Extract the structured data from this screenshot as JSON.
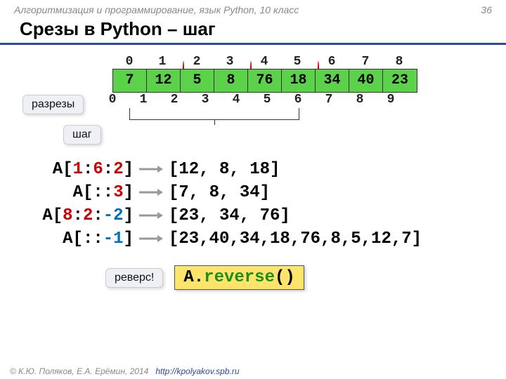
{
  "header": {
    "course": "Алгоритмизация и программирование, язык Python, 10 класс",
    "page": "36"
  },
  "title": "Срезы в Python – шаг",
  "array": {
    "top_indices": [
      "0",
      "1",
      "2",
      "3",
      "4",
      "5",
      "6",
      "7",
      "8"
    ],
    "circled_top": [
      1,
      3,
      5
    ],
    "values": [
      "7",
      "12",
      "5",
      "8",
      "76",
      "18",
      "34",
      "40",
      "23"
    ],
    "bottom_indices": [
      "0",
      "1",
      "2",
      "3",
      "4",
      "5",
      "6",
      "7",
      "8",
      "9"
    ]
  },
  "callouts": {
    "slices": "разрезы",
    "step": "шаг",
    "reverse": "реверс!"
  },
  "examples": [
    {
      "expr": {
        "open": "A[",
        "a": "1",
        "c1": ":",
        "b": "6",
        "c2": ":",
        "step": "2",
        "close": "]"
      },
      "result": "[12, 8, 18]"
    },
    {
      "expr": {
        "open": "A[",
        "a": "",
        "c1": ":",
        "b": "",
        "c2": ":",
        "step": "3",
        "close": "]"
      },
      "result": "[7, 8, 34]"
    },
    {
      "expr": {
        "open": "A[",
        "a": "8",
        "c1": ":",
        "b": "2",
        "c2": ":",
        "step": "-2",
        "close": "]"
      },
      "result": "[23, 34, 76]"
    },
    {
      "expr": {
        "open": "A[",
        "a": "",
        "c1": ":",
        "b": "",
        "c2": ":",
        "step": "-1",
        "close": "]"
      },
      "result": "[23,40,34,18,76,8,5,12,7]"
    }
  ],
  "reverse_code": {
    "obj": "A.",
    "method": "reverse",
    "paren": "()"
  },
  "footer": {
    "copyright": "© К.Ю. Поляков, Е.А. Ерёмин, 2014",
    "url": "http://kpolyakov.spb.ru"
  }
}
